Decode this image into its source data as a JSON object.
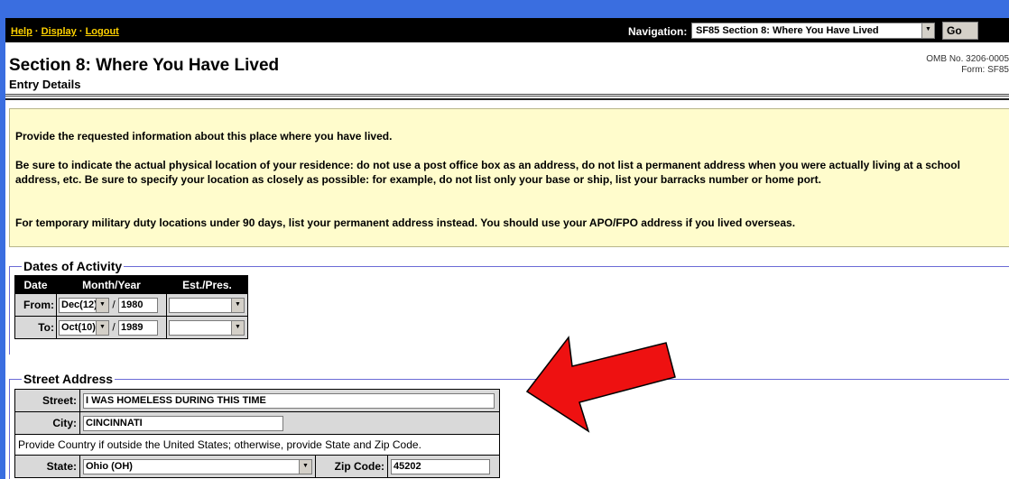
{
  "nav": {
    "help": "Help",
    "display": "Display",
    "logout": "Logout",
    "sep": "·",
    "navigation_label": "Navigation:",
    "navigation_selected": "SF85 Section 8: Where You Have Lived",
    "go_label": "Go"
  },
  "header": {
    "title": "Section 8: Where You Have Lived",
    "subtitle": "Entry Details",
    "omb": "OMB No. 3206-0005",
    "form": "Form: SF85"
  },
  "instructions": {
    "p1": "Provide the requested information about this place where you have lived.",
    "p2": "Be sure to indicate the actual physical location of your residence: do not use a post office box as an address, do not list a permanent address when you were actually living at a school address, etc. Be sure to specify your location as closely as possible: for example, do not list only your base or ship, list your barracks number or home port.",
    "p3": "For temporary military duty locations under 90 days, list your permanent address instead. You should use your APO/FPO address if you lived overseas."
  },
  "dates": {
    "legend": "Dates of Activity",
    "headers": [
      "Date",
      "Month/Year",
      "Est./Pres."
    ],
    "from_label": "From:",
    "to_label": "To:",
    "slash": "/",
    "from_month": "Dec(12)",
    "from_year": "1980",
    "from_est": "",
    "to_month": "Oct(10)",
    "to_year": "1989",
    "to_est": ""
  },
  "address": {
    "legend": "Street Address",
    "street_label": "Street:",
    "street_value": "I WAS HOMELESS DURING THIS TIME",
    "city_label": "City:",
    "city_value": "CINCINNATI",
    "note": "Provide Country if outside the United States; otherwise, provide State and Zip Code.",
    "state_label": "State:",
    "state_value": "Ohio (OH)",
    "zip_label": "Zip Code:",
    "zip_value": "45202"
  },
  "colors": {
    "frame": "#3a6ee0",
    "nav_link": "#ffd200",
    "info_bg": "#fffccc",
    "arrow": "#ee1111"
  },
  "icons": {
    "dropdown": "chevron-down-icon",
    "annotation": "red-arrow-icon"
  }
}
